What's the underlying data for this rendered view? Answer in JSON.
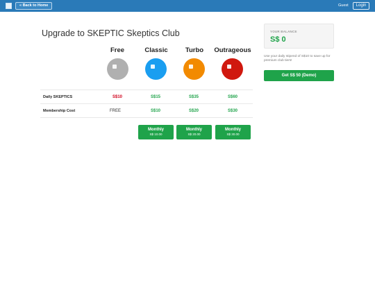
{
  "topbar": {
    "back_label": "« Back to Home",
    "guest_label": "Guest",
    "login_label": "Login"
  },
  "page": {
    "title": "Upgrade to SKEPTIC Skeptics Club"
  },
  "plans": [
    {
      "name": "Free",
      "color": "#b0b0b0",
      "daily": "S$10",
      "membership": "FREE"
    },
    {
      "name": "Classic",
      "color": "#1a9ef0",
      "daily": "S$15",
      "membership": "S$10",
      "monthly_label": "Monthly",
      "monthly_price": "S$ 10.00"
    },
    {
      "name": "Turbo",
      "color": "#f28a00",
      "daily": "S$35",
      "membership": "S$20",
      "monthly_label": "Monthly",
      "monthly_price": "S$ 20.00"
    },
    {
      "name": "Outrageous",
      "color": "#d0180e",
      "daily": "S$60",
      "membership": "S$30",
      "monthly_label": "Monthly",
      "monthly_price": "S$ 30.00"
    }
  ],
  "rows": {
    "daily_label": "Daily SKEPTICS",
    "membership_label": "Membership Cost"
  },
  "sidebar": {
    "balance_label": "YOUR BALANCE",
    "balance_value": "S$ 0",
    "stipend_text": "Use your daily stipend of S$10 to save up for premium club tiers!",
    "get_button": "Get S$ 50 (Demo)"
  },
  "colors": {
    "accent": "#2a7ab8",
    "green": "#1fa34a",
    "red": "#d0021b"
  }
}
